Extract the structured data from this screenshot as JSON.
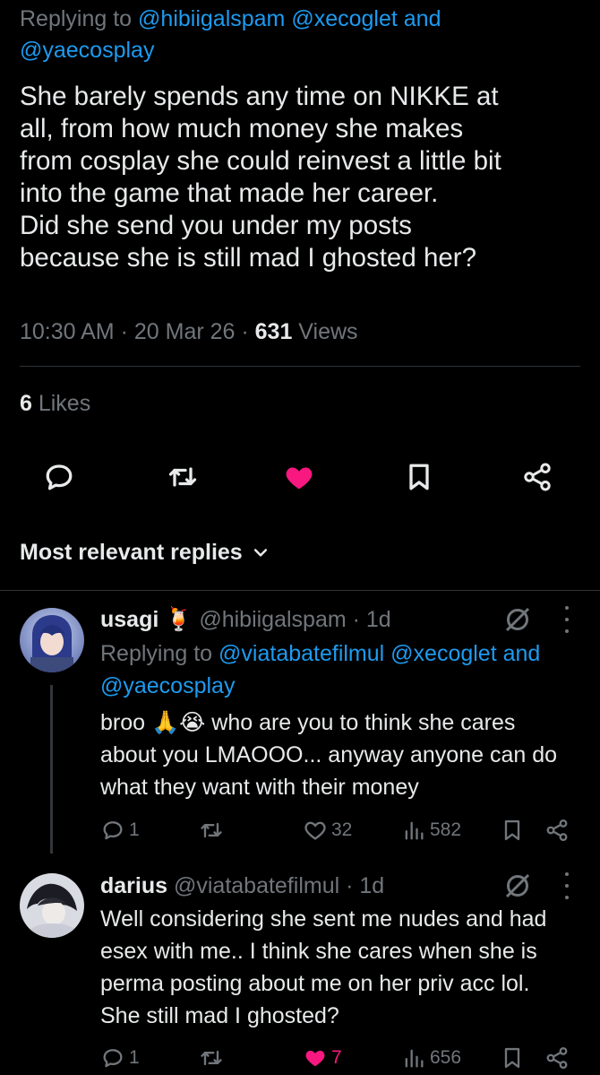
{
  "main_tweet": {
    "replying_prefix": "Replying to ",
    "replying_handles": "@hibiigalspam @xecoglet and @yaecosplay",
    "text": "She barely spends any time on NIKKE at\nall, from how much money she makes\nfrom cosplay she could reinvest a little bit\ninto the game that made her career.\nDid she send you under my posts\nbecause she is still mad I ghosted her?",
    "time": "10:30 AM",
    "date": "20 Mar 26",
    "views_count": "631",
    "views_label": " Views",
    "likes_count": "6",
    "likes_label": " Likes"
  },
  "actions": {
    "icons": [
      "reply-icon",
      "retweet-icon",
      "like-icon",
      "bookmark-icon",
      "share-icon"
    ],
    "liked": true,
    "like_color": "#f91880"
  },
  "sort": {
    "label": "Most relevant replies"
  },
  "replies": [
    {
      "display_name": "usagi 🍹",
      "handle": "@hibiigalspam",
      "age": "1d",
      "replying_prefix": "Replying to ",
      "replying_handles": "@viatabatefilmul @xecoglet and @yaecosplay",
      "text": "broo 🙏😭 who are you to think she cares about you LMAOOO... anyway anyone can do what they want with their money",
      "replies": "1",
      "retweets": "",
      "likes": "32",
      "views": "582",
      "liked": false
    },
    {
      "display_name": "darius",
      "handle": "@viatabatefilmul",
      "age": "1d",
      "text": "Well considering she sent me nudes and had esex with me.. I think she cares when she is perma posting about me on her priv acc lol. She still mad I ghosted?",
      "replies": "1",
      "retweets": "",
      "likes": "7",
      "views": "656",
      "liked": true
    }
  ],
  "colors": {
    "background": "#000000",
    "text": "#e7e9ea",
    "muted": "#71767b",
    "accent": "#1d9bf0",
    "like": "#f91880"
  }
}
